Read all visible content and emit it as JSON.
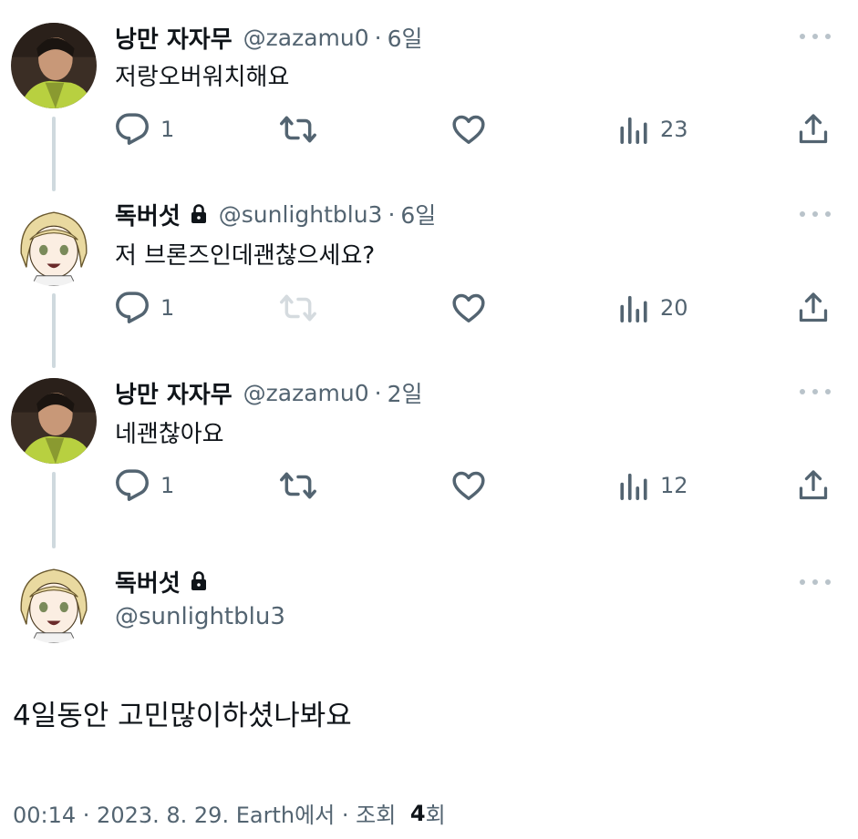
{
  "replies": [
    {
      "name": "낭만 자자무",
      "handle": "@zazamu0",
      "time": "6일",
      "text": "저랑오버워치해요",
      "protected": false,
      "reply_count": "1",
      "views": "23",
      "retweet_disabled": false
    },
    {
      "name": "독버섯",
      "handle": "@sunlightblu3",
      "time": "6일",
      "text": "저 브론즈인데괜찮으세요?",
      "protected": true,
      "reply_count": "1",
      "views": "20",
      "retweet_disabled": true
    },
    {
      "name": "낭만 자자무",
      "handle": "@zazamu0",
      "time": "2일",
      "text": "네괜찮아요",
      "protected": false,
      "reply_count": "1",
      "views": "12",
      "retweet_disabled": false
    }
  ],
  "separator": "·",
  "main_tweet": {
    "name": "독버섯",
    "handle": "@sunlightblu3",
    "text": "4일동안 고민많이하셨나봐요",
    "meta_prefix": "00:14 · 2023. 8. 29. Earth에서 · 조회 ",
    "views_count": "4",
    "views_suffix": "회"
  },
  "icons": {
    "reply": "speech-bubble-icon",
    "retweet": "retweet-arrows-icon",
    "like": "heart-icon",
    "views": "bar-chart-icon",
    "share": "upload-arrow-icon",
    "more": "ellipsis-icon",
    "protected": "lock-icon"
  },
  "colors": {
    "text_primary": "#0f1419",
    "text_secondary": "#536471",
    "thread_line": "#cfd9de"
  }
}
